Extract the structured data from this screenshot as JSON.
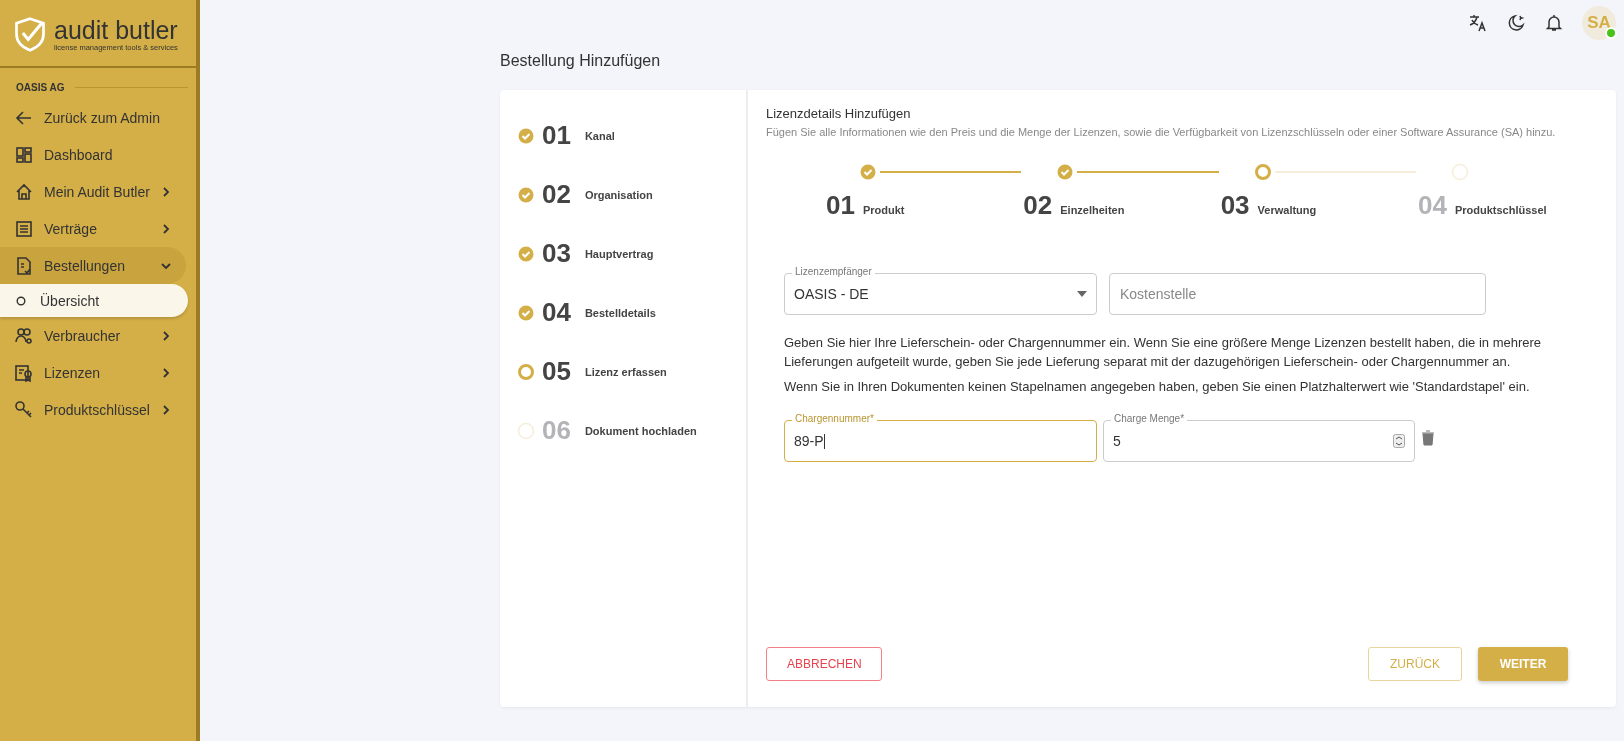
{
  "brand": {
    "name": "audit butler",
    "tagline": "license management tools & services"
  },
  "sidebar": {
    "section": "OASIS AG",
    "items": [
      {
        "label": "Zurück zum Admin",
        "kind": "arrow",
        "has_children": false
      },
      {
        "label": "Dashboard",
        "kind": "grid",
        "has_children": false
      },
      {
        "label": "Mein Audit Butler",
        "kind": "home",
        "has_children": true,
        "expanded": false
      },
      {
        "label": "Verträge",
        "kind": "doc",
        "has_children": true,
        "expanded": false
      },
      {
        "label": "Bestellungen",
        "kind": "order",
        "has_children": true,
        "expanded": true,
        "children": [
          {
            "label": "Übersicht",
            "selected": true
          }
        ]
      },
      {
        "label": "Verbraucher",
        "kind": "users",
        "has_children": true,
        "expanded": false
      },
      {
        "label": "Lizenzen",
        "kind": "cert",
        "has_children": true,
        "expanded": false
      },
      {
        "label": "Produktschlüssel",
        "kind": "key",
        "has_children": true,
        "expanded": false
      }
    ]
  },
  "topbar": {
    "avatar": "SA",
    "online": true
  },
  "page_title": "Bestellung Hinzufügen",
  "steps": [
    {
      "number": "01",
      "label": "Kanal",
      "completed": true,
      "selected": false
    },
    {
      "number": "02",
      "label": "Organisation",
      "completed": true,
      "selected": false
    },
    {
      "number": "03",
      "label": "Hauptvertrag",
      "completed": true,
      "selected": false
    },
    {
      "number": "04",
      "label": "Bestelldetails",
      "completed": true,
      "selected": false
    },
    {
      "number": "05",
      "label": "Lizenz erfassen",
      "completed": false,
      "selected": true
    },
    {
      "number": "06",
      "label": "Dokument hochladen",
      "completed": false,
      "selected": false
    }
  ],
  "panel": {
    "title": "Lizenzdetails Hinzufügen",
    "description": "Fügen Sie alle Informationen wie den Preis und die Menge der Lizenzen, sowie die Verfügbarkeit von Lizenzschlüsseln oder einer Software Assurance (SA) hinzu.",
    "substeps": [
      {
        "number": "01",
        "label": "Produkt",
        "completed": true,
        "selected": false
      },
      {
        "number": "02",
        "label": "Einzelheiten",
        "completed": true,
        "selected": false
      },
      {
        "number": "03",
        "label": "Verwaltung",
        "completed": false,
        "selected": true
      },
      {
        "number": "04",
        "label": "Produktschlüssel",
        "completed": false,
        "selected": false
      }
    ],
    "recipient": {
      "label": "Lizenzempfänger",
      "value": "OASIS - DE"
    },
    "cost_center": {
      "placeholder": "Kostenstelle"
    },
    "info": [
      "Geben Sie hier Ihre Lieferschein- oder Chargennummer ein. Wenn Sie eine größere Menge Lizenzen bestellt haben, die in mehrere Lieferungen aufgeteilt wurde, geben Sie jede Lieferung separat mit der dazugehörigen Lieferschein- oder Chargennummer an.",
      "Wenn Sie in Ihren Dokumenten keinen Stapelnamen angegeben haben, geben Sie einen Platzhalterwert wie 'Standardstapel' ein."
    ],
    "batch": {
      "label": "Chargennummer*",
      "value": "89-P",
      "focused": true
    },
    "quantity": {
      "label": "Charge Menge*",
      "value": "5"
    },
    "buttons": {
      "cancel": "ABBRECHEN",
      "back": "ZURÜCK",
      "next": "WEITER"
    }
  }
}
